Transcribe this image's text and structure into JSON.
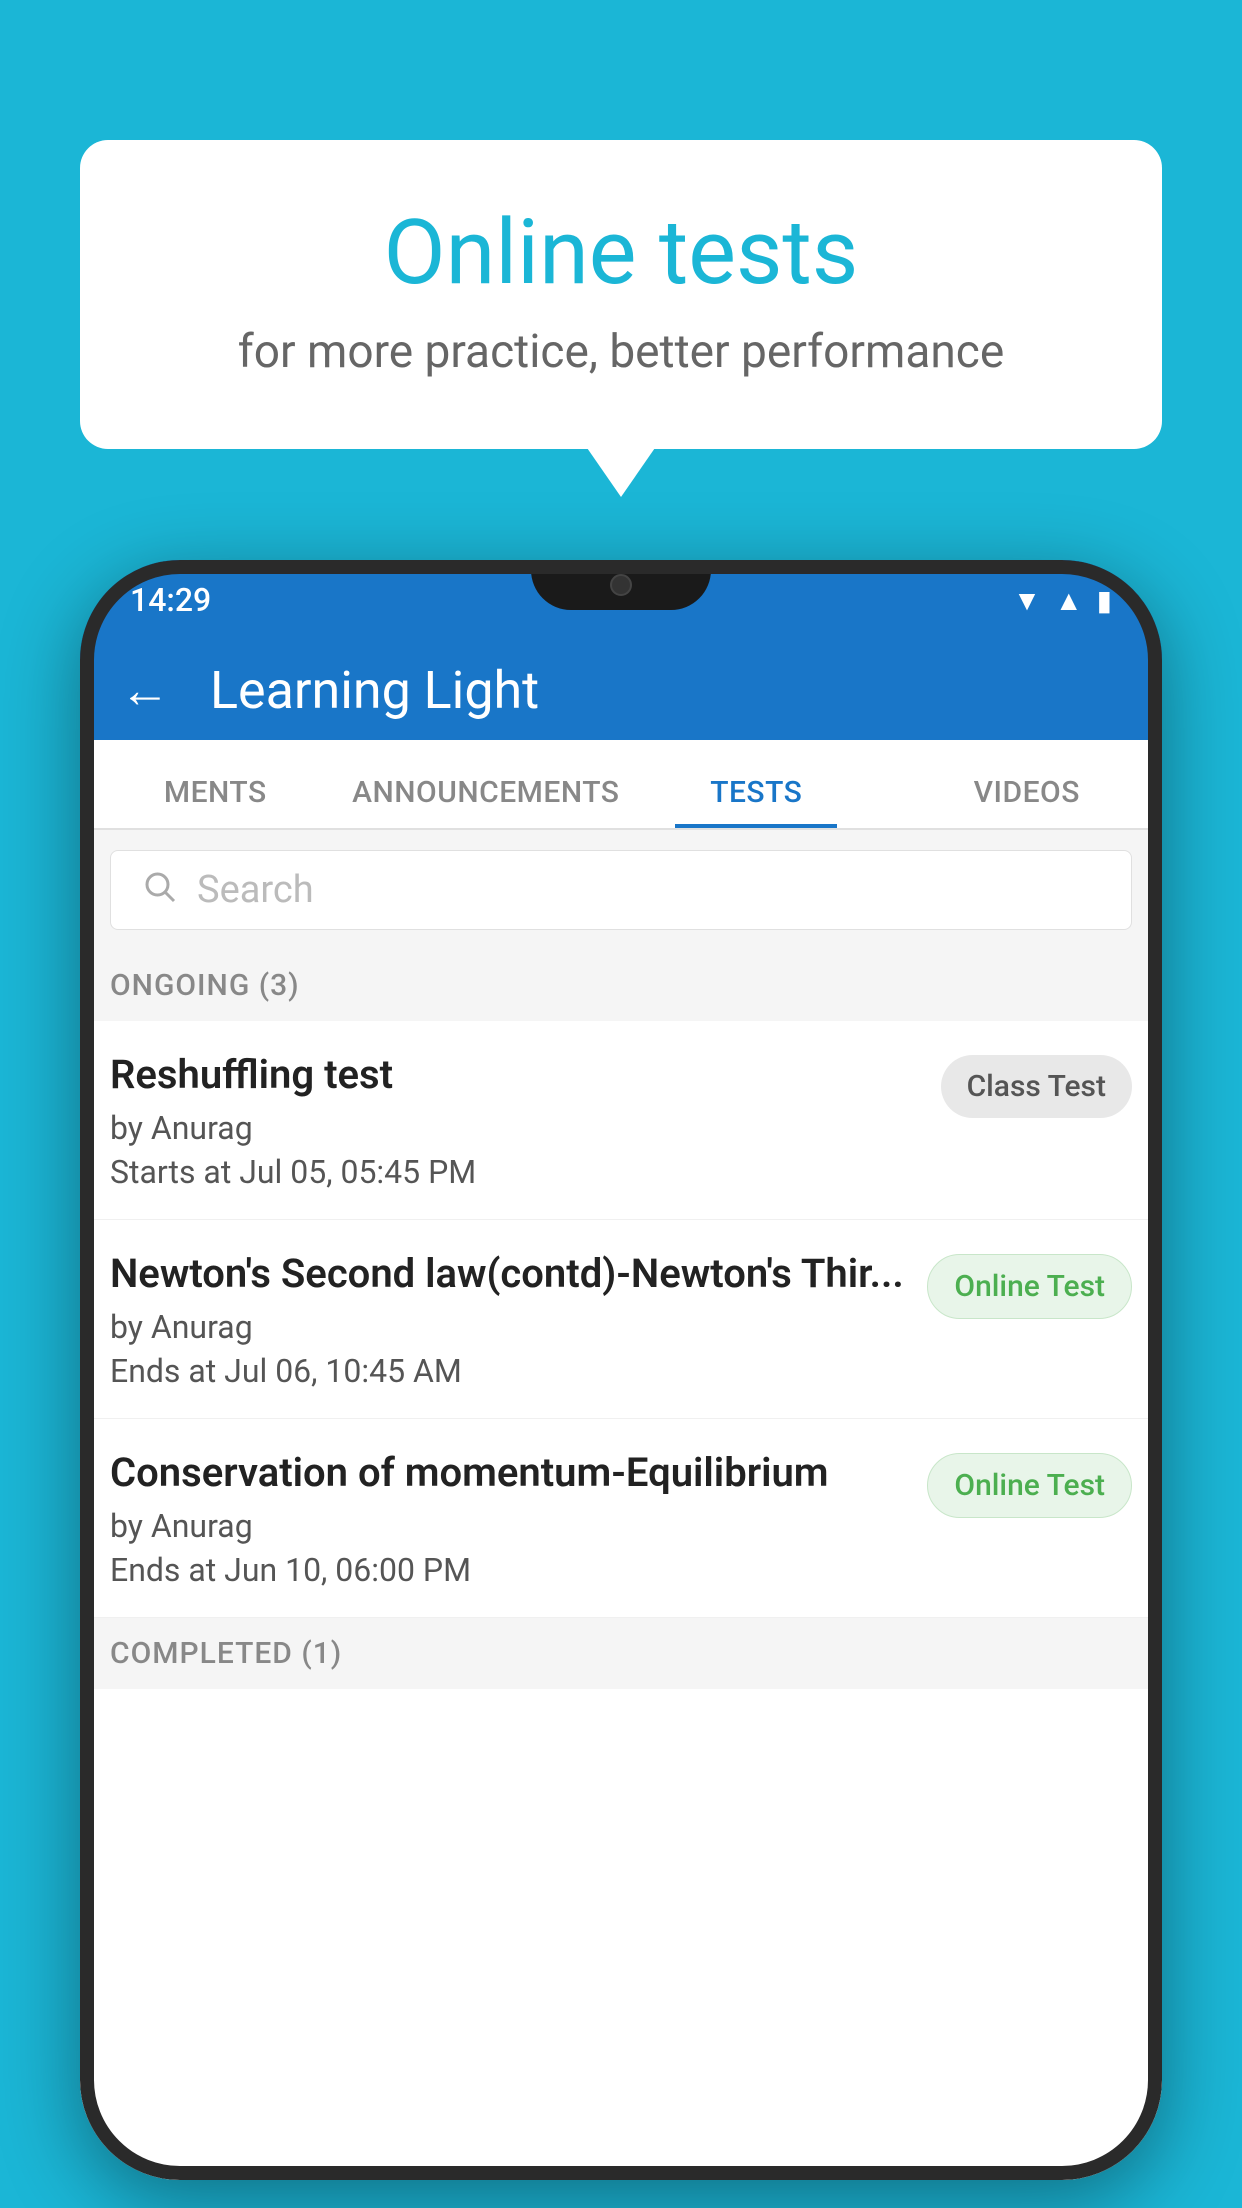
{
  "background": {
    "color": "#1bb6d6"
  },
  "speech_bubble": {
    "title": "Online tests",
    "subtitle": "for more practice, better performance"
  },
  "phone": {
    "status_bar": {
      "time": "14:29",
      "icons": [
        "wifi",
        "signal",
        "battery"
      ]
    },
    "app_header": {
      "title": "Learning Light",
      "back_label": "←"
    },
    "tabs": [
      {
        "label": "MENTS",
        "active": false
      },
      {
        "label": "ANNOUNCEMENTS",
        "active": false
      },
      {
        "label": "TESTS",
        "active": true
      },
      {
        "label": "VIDEOS",
        "active": false
      }
    ],
    "search": {
      "placeholder": "Search"
    },
    "sections": [
      {
        "label": "ONGOING (3)",
        "items": [
          {
            "name": "Reshuffling test",
            "by": "by Anurag",
            "date": "Starts at  Jul 05, 05:45 PM",
            "badge": "Class Test",
            "badge_type": "class"
          },
          {
            "name": "Newton's Second law(contd)-Newton's Thir...",
            "by": "by Anurag",
            "date": "Ends at  Jul 06, 10:45 AM",
            "badge": "Online Test",
            "badge_type": "online"
          },
          {
            "name": "Conservation of momentum-Equilibrium",
            "by": "by Anurag",
            "date": "Ends at  Jun 10, 06:00 PM",
            "badge": "Online Test",
            "badge_type": "online"
          }
        ]
      }
    ],
    "completed_label": "COMPLETED (1)"
  }
}
